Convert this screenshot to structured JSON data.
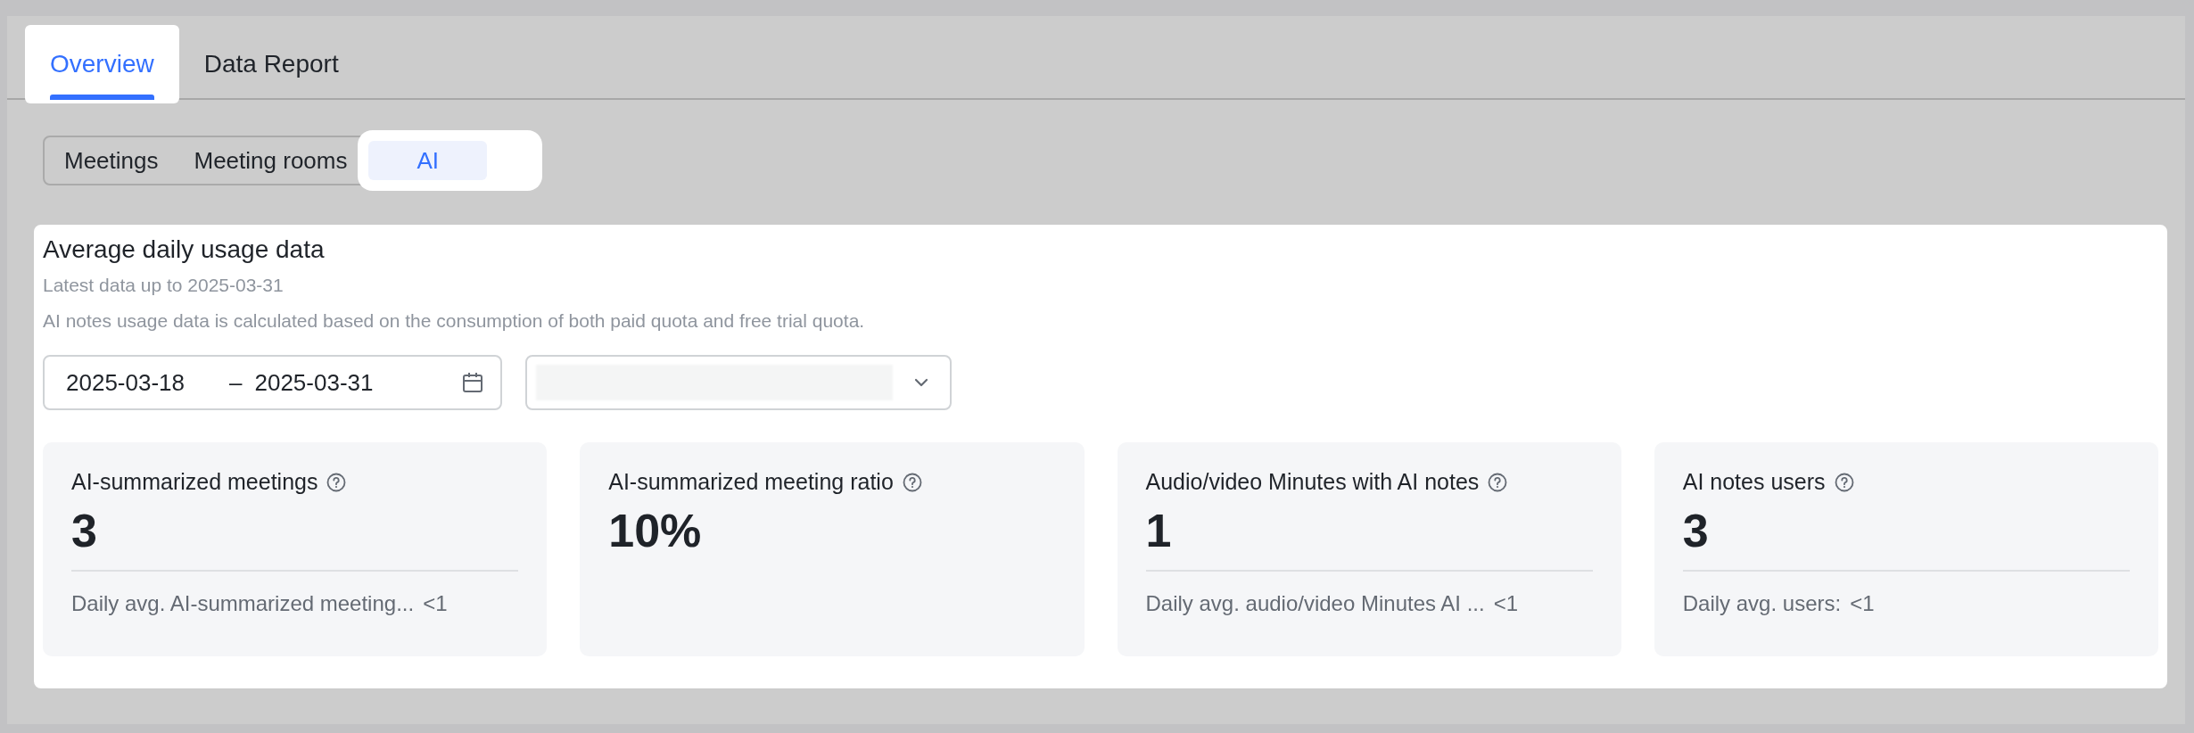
{
  "tabs": [
    {
      "label": "Overview",
      "selected": true
    },
    {
      "label": "Data Report",
      "selected": false
    }
  ],
  "segments": [
    {
      "label": "Meetings",
      "selected": false
    },
    {
      "label": "Meeting rooms",
      "selected": false
    },
    {
      "label": "AI",
      "selected": true
    }
  ],
  "panel": {
    "title": "Average daily usage data",
    "subtitle": "Latest data up to 2025-03-31",
    "note": "AI notes usage data is calculated based on the consumption of both paid quota and free trial quota.",
    "date_range": {
      "start": "2025-03-18",
      "separator": "–",
      "end": "2025-03-31"
    },
    "dropdown": {
      "value_blurred": true
    },
    "metrics": [
      {
        "label": "AI-summarized meetings",
        "value": "3",
        "footer": "Daily avg. AI-summarized meeting...",
        "footer_value": "<1"
      },
      {
        "label": "AI-summarized meeting ratio",
        "value": "10%"
      },
      {
        "label": "Audio/video Minutes with AI notes",
        "value": "1",
        "footer": "Daily avg. audio/video Minutes AI ...",
        "footer_value": "<1"
      },
      {
        "label": "AI notes users",
        "value": "3",
        "footer": "Daily avg. users:",
        "footer_value": "<1"
      }
    ]
  }
}
